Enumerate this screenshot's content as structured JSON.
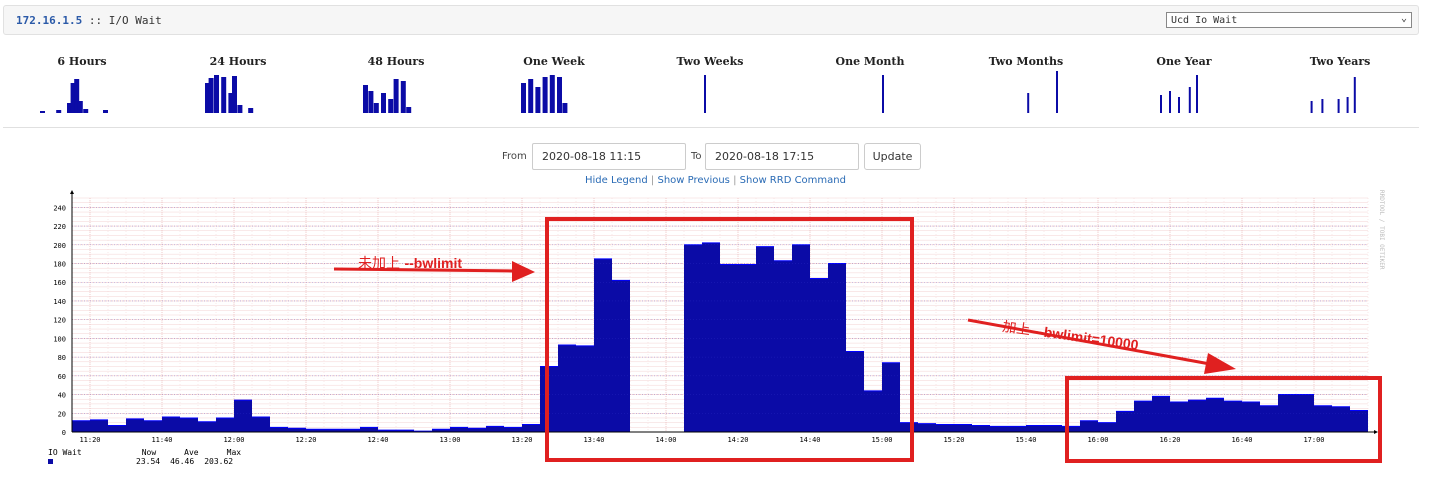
{
  "header": {
    "host": "172.16.1.5",
    "separator": " :: ",
    "title": "I/O Wait",
    "graph_select": "Ucd Io Wait"
  },
  "thumbnails": [
    {
      "label": "6 Hours"
    },
    {
      "label": "24 Hours"
    },
    {
      "label": "48 Hours"
    },
    {
      "label": "One Week"
    },
    {
      "label": "Two Weeks"
    },
    {
      "label": "One Month"
    },
    {
      "label": "Two Months"
    },
    {
      "label": "One Year"
    },
    {
      "label": "Two Years"
    }
  ],
  "range": {
    "from_label": "From",
    "from_value": "2020-08-18 11:15",
    "to_label": "To",
    "to_value": "2020-08-18 17:15",
    "update_label": "Update"
  },
  "links": {
    "hide_legend": "Hide Legend",
    "show_previous": "Show Previous",
    "show_rrd": "Show RRD Command",
    "sep": "|"
  },
  "legend": {
    "series": "IO Wait",
    "now_label": "Now",
    "ave_label": "Ave",
    "max_label": "Max",
    "now": "23.54",
    "ave": "46.46",
    "max": "203.62"
  },
  "watermark": "RRDTOOL / TOBI OETIKER",
  "annotations": {
    "before_cn": "未加上",
    "before_flag": "--bwlimit",
    "after_cn": "加上",
    "after_flag": "--bwlimit=10000"
  },
  "colors": {
    "series": "#0b0ba6",
    "annotation": "#e02020",
    "link": "#2a6bb5"
  },
  "chart_data": {
    "type": "area",
    "series_name": "IO Wait",
    "ylim": [
      0,
      250
    ],
    "yticks": [
      0,
      20,
      40,
      60,
      80,
      100,
      120,
      140,
      160,
      180,
      200,
      220,
      240
    ],
    "xlim": [
      "11:15",
      "17:15"
    ],
    "xticks": [
      "11:20",
      "11:40",
      "12:00",
      "12:20",
      "12:40",
      "13:00",
      "13:20",
      "13:40",
      "14:00",
      "14:20",
      "14:40",
      "15:00",
      "15:20",
      "15:40",
      "16:00",
      "16:20",
      "16:40",
      "17:00"
    ],
    "x": [
      "11:15",
      "11:20",
      "11:25",
      "11:30",
      "11:35",
      "11:40",
      "11:45",
      "11:50",
      "11:55",
      "12:00",
      "12:05",
      "12:10",
      "12:15",
      "12:20",
      "12:25",
      "12:30",
      "12:35",
      "12:40",
      "12:45",
      "12:50",
      "12:55",
      "13:00",
      "13:05",
      "13:10",
      "13:15",
      "13:20",
      "13:25",
      "13:30",
      "13:35",
      "13:40",
      "13:45",
      "13:50",
      "13:55",
      "14:00",
      "14:05",
      "14:10",
      "14:15",
      "14:20",
      "14:25",
      "14:30",
      "14:35",
      "14:40",
      "14:45",
      "14:50",
      "14:55",
      "15:00",
      "15:05",
      "15:10",
      "15:15",
      "15:20",
      "15:25",
      "15:30",
      "15:35",
      "15:40",
      "15:45",
      "15:50",
      "15:55",
      "16:00",
      "16:05",
      "16:10",
      "16:15",
      "16:20",
      "16:25",
      "16:30",
      "16:35",
      "16:40",
      "16:45",
      "16:50",
      "16:55",
      "17:00",
      "17:05",
      "17:10"
    ],
    "values": [
      12,
      13,
      7,
      14,
      12,
      16,
      15,
      11,
      15,
      34,
      16,
      5,
      4,
      3,
      3,
      3,
      5,
      2,
      2,
      1,
      3,
      5,
      4,
      6,
      5,
      8,
      70,
      93,
      92,
      185,
      162,
      0,
      0,
      0,
      200,
      202,
      179,
      179,
      198,
      183,
      200,
      164,
      180,
      86,
      44,
      74,
      10,
      9,
      8,
      8,
      7,
      6,
      6,
      7,
      7,
      6,
      12,
      10,
      22,
      33,
      38,
      32,
      34,
      36,
      33,
      32,
      28,
      40,
      40,
      28,
      27,
      23
    ],
    "unit_label": "",
    "highlight_boxes": [
      "13:25-15:05",
      "15:55-17:15"
    ]
  }
}
